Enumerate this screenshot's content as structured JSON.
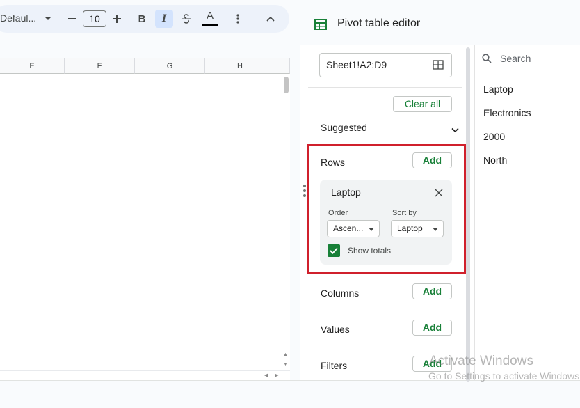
{
  "toolbar": {
    "font_name": "Defaul...",
    "font_size": "10",
    "bold_label": "B",
    "italic_label": "I",
    "text_color_label": "A"
  },
  "sheet": {
    "columns": [
      "E",
      "F",
      "G",
      "H"
    ]
  },
  "pivot_editor": {
    "title": "Pivot table editor",
    "range": "Sheet1!A2:D9",
    "clear_all_label": "Clear all",
    "suggested_label": "Suggested",
    "rows": {
      "label": "Rows",
      "add_label": "Add",
      "card": {
        "title": "Laptop",
        "order_label": "Order",
        "order_value": "Ascen...",
        "sort_by_label": "Sort by",
        "sort_by_value": "Laptop",
        "show_totals_label": "Show totals",
        "show_totals_checked": true
      }
    },
    "columns": {
      "label": "Columns",
      "add_label": "Add"
    },
    "values": {
      "label": "Values",
      "add_label": "Add"
    },
    "filters": {
      "label": "Filters",
      "add_label": "Add"
    }
  },
  "value_list": {
    "search_placeholder": "Search",
    "items": [
      "Laptop",
      "Electronics",
      "2000",
      "North"
    ]
  },
  "watermark": {
    "line1": "Activate Windows",
    "line2": "Go to Settings to activate Windows."
  },
  "colors": {
    "accent_green": "#188038",
    "highlight_red": "#d0202c",
    "toolbar_bg": "#edf2fa"
  }
}
